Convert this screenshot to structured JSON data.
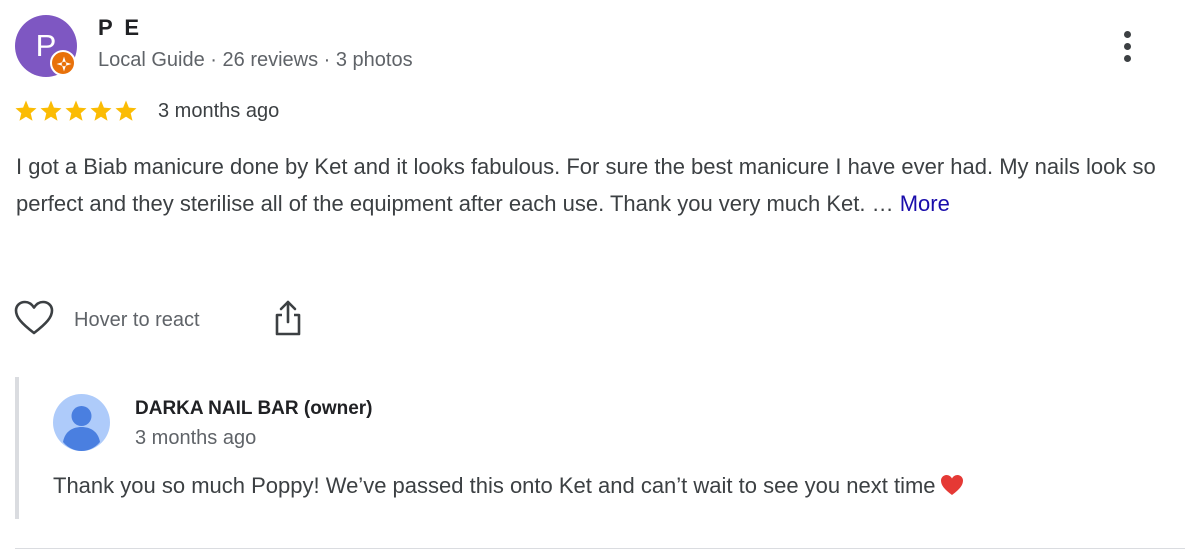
{
  "reviewer": {
    "avatar_letter": "P",
    "name": "P E",
    "meta": "Local Guide · 26 reviews · 3 photos",
    "badge_icon": "local-guide-badge-icon",
    "avatar_color": "#7e57c2"
  },
  "rating": {
    "stars": 5,
    "max_stars": 5,
    "star_color": "#fbbc04",
    "date": "3 months ago"
  },
  "review": {
    "text": "I got a Biab manicure done by Ket and it looks fabulous. For sure the best manicure I have ever had. My nails look so perfect and they sterilise all of the equipment after each use. Thank you very much Ket. … ",
    "more_label": "More"
  },
  "actions": {
    "react_label": "Hover to react",
    "react_icon": "heart-outline-icon",
    "share_icon": "share-icon"
  },
  "owner_response": {
    "name": "DARKA NAIL BAR (owner)",
    "date": "3 months ago",
    "text": "Thank you so much Poppy! We’ve passed this onto Ket and can’t wait to see you next time",
    "avatar_icon": "default-profile-icon",
    "end_icon": "red-heart-icon"
  },
  "menu": {
    "icon": "more-vert-icon"
  }
}
